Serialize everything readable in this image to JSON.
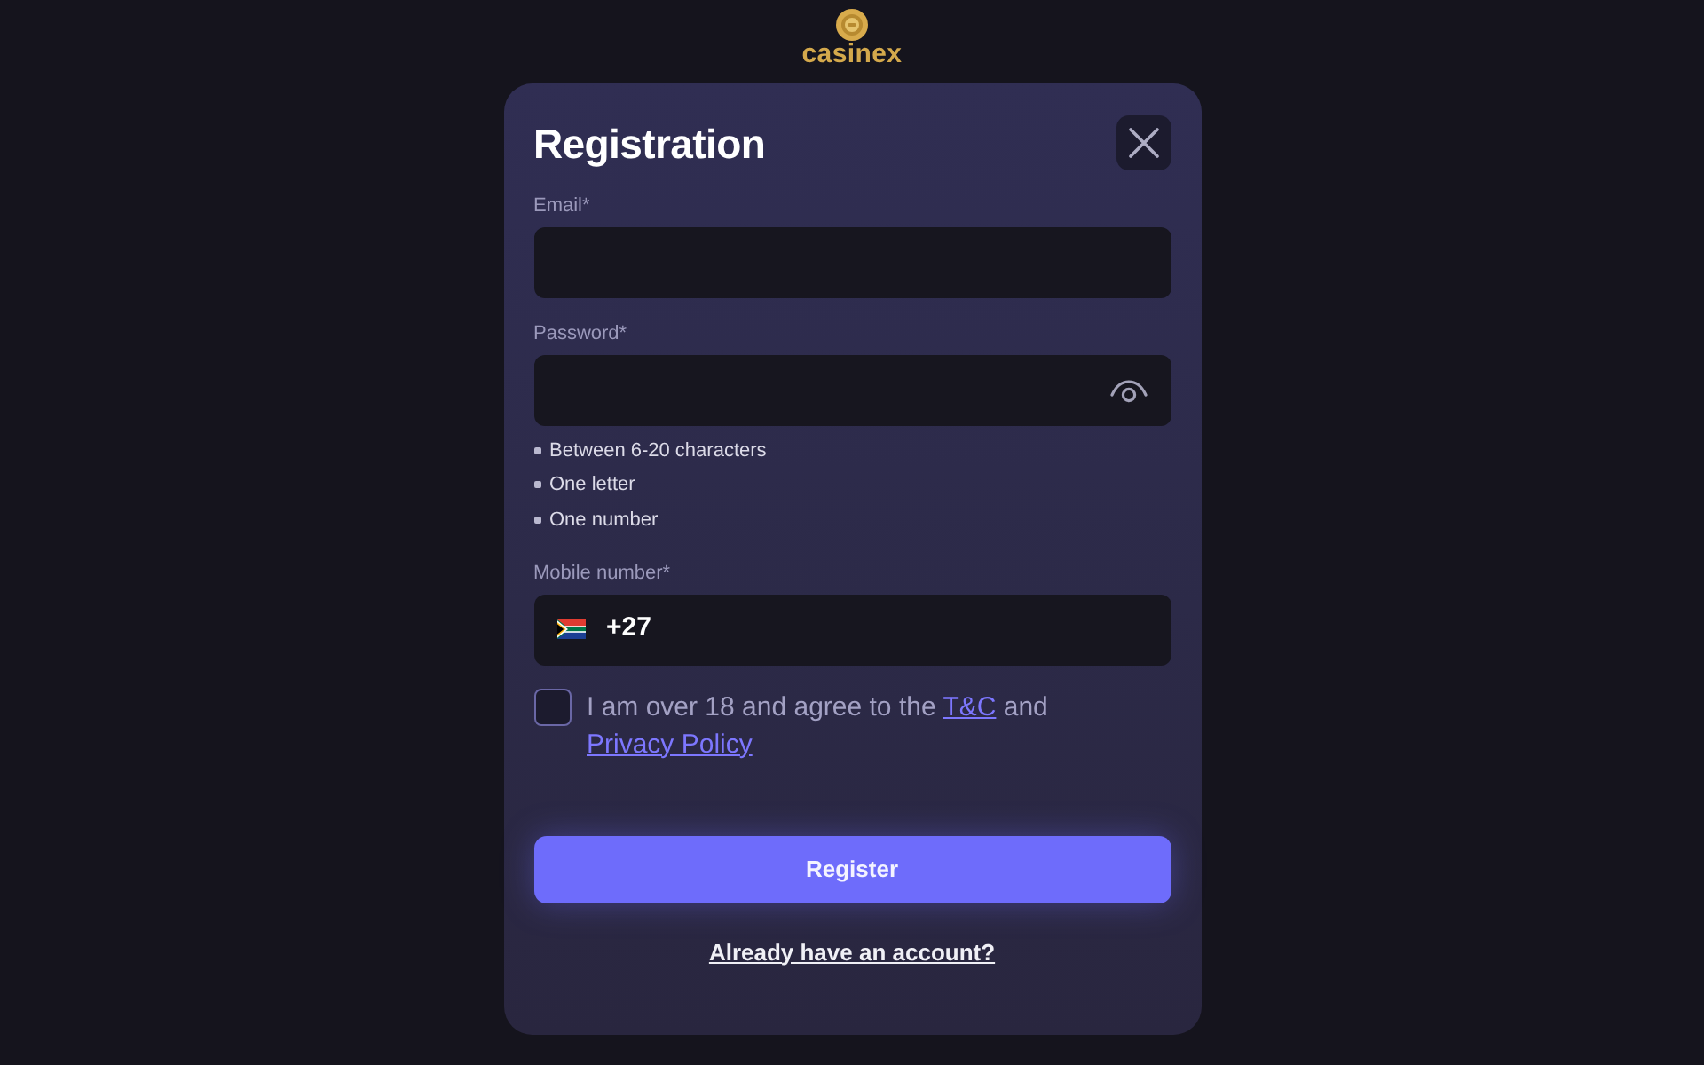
{
  "logo": {
    "text": "casinex"
  },
  "dialog": {
    "title": "Registration"
  },
  "fields": [
    {
      "kind": "email",
      "label": "Email*"
    },
    {
      "kind": "password",
      "label": "Password*",
      "hints": [
        "Between 6-20 characters",
        "One letter",
        "One number"
      ]
    },
    {
      "kind": "phone",
      "label": "Mobile number*",
      "value": "+27"
    }
  ],
  "agreement": {
    "checked": false,
    "parts": [
      {
        "kind": "text",
        "text": "I am over 18 and agree to the"
      },
      {
        "kind": "link",
        "text": "T&C"
      },
      {
        "kind": "text",
        "text": "and"
      },
      {
        "kind": "link",
        "text": "Privacy Policy"
      }
    ]
  },
  "register_button": "Register",
  "login_link": "Already have an account?"
}
